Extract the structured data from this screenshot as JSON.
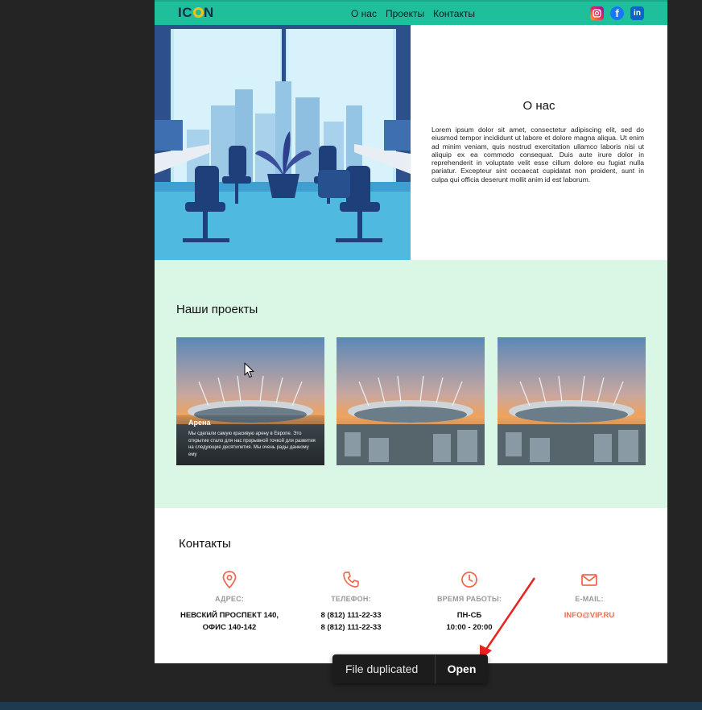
{
  "header": {
    "logo": "ICON",
    "nav": [
      "О нас",
      "Проекты",
      "Контакты"
    ],
    "socials": [
      "instagram-icon",
      "facebook-icon",
      "linkedin-icon"
    ]
  },
  "about": {
    "title": "О нас",
    "text": "Lorem ipsum dolor sit amet, consectetur adipiscing elit, sed do eiusmod tempor incididunt ut labore et dolore magna aliqua. Ut enim ad minim veniam, quis nostrud exercitation ullamco laboris nisi ut aliquip ex ea commodo consequat. Duis aute irure dolor in reprehenderit in voluptate velit esse cillum dolore eu fugiat nulla pariatur. Excepteur sint occaecat cupidatat non proident, sunt in culpa qui officia deserunt mollit anim id est laborum."
  },
  "projects": {
    "title": "Наши проекты",
    "cards": [
      {
        "name": "Арена",
        "desc": "Мы сделали самую красивую арену в Европе. Это открытие стало для нас прорывной точкой для развития на следующие десятилетия. Мы очень рады данному ему"
      },
      {
        "name": "",
        "desc": ""
      },
      {
        "name": "",
        "desc": ""
      }
    ]
  },
  "contacts": {
    "title": "Контакты",
    "items": [
      {
        "icon": "location-icon",
        "label": "АДРЕС:",
        "line1": "НЕВСКИЙ ПРОСПЕКТ 140,",
        "line2": "ОФИС 140-142"
      },
      {
        "icon": "phone-icon",
        "label": "ТЕЛЕФОН:",
        "line1": "8 (812) 111-22-33",
        "line2": "8 (812) 111-22-33"
      },
      {
        "icon": "clock-icon",
        "label": "ВРЕМЯ РАБОТЫ:",
        "line1": "ПН-СБ",
        "line2": "10:00 - 20:00"
      },
      {
        "icon": "mail-icon",
        "label": "E-MAIL:",
        "line1": "INFO@VIP.RU",
        "line2": ""
      }
    ]
  },
  "toast": {
    "message": "File duplicated",
    "action": "Open"
  },
  "colors": {
    "header": "#1fbf9c",
    "projects_bg": "#daf7e6",
    "accent": "#ef6b4f",
    "logo_dot": "#f4c313"
  }
}
